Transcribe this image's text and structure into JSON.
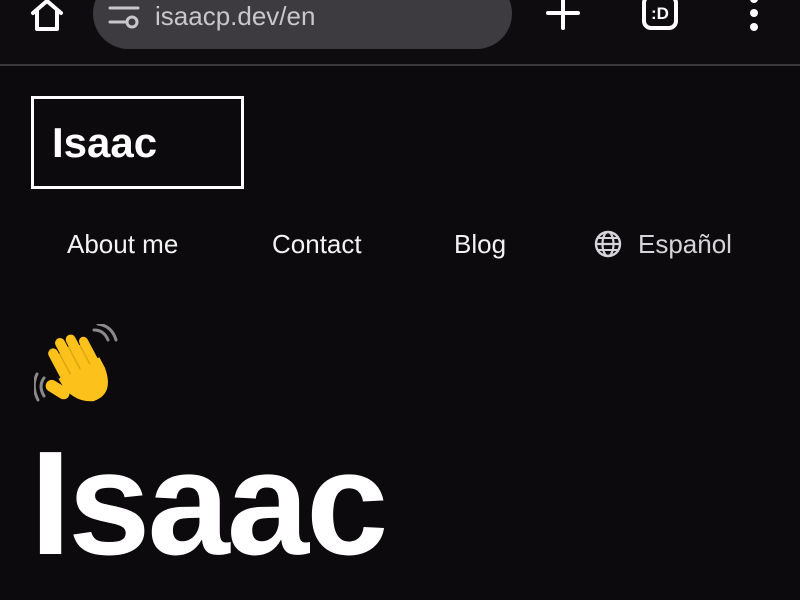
{
  "browser": {
    "url": "isaacp.dev/en",
    "icons": {
      "home": "home-icon",
      "site_settings": "tune-icon",
      "new_tab": "plus-icon",
      "tab_switcher": "tab-switcher-icon",
      "tab_switcher_glyph": ":D",
      "menu": "more-vertical-icon"
    }
  },
  "site": {
    "logo_text": "Isaac",
    "nav": {
      "about": "About me",
      "contact": "Contact",
      "blog": "Blog",
      "language": "Español"
    },
    "hero": {
      "emoji": "waving-hand-icon",
      "title": "Isaac"
    }
  },
  "colors": {
    "background": "#0c0a0c",
    "url_pill": "#3d3b3f",
    "text": "#ffffff",
    "muted": "#c9c7cb",
    "wave_yellow": "#fcc21b"
  }
}
